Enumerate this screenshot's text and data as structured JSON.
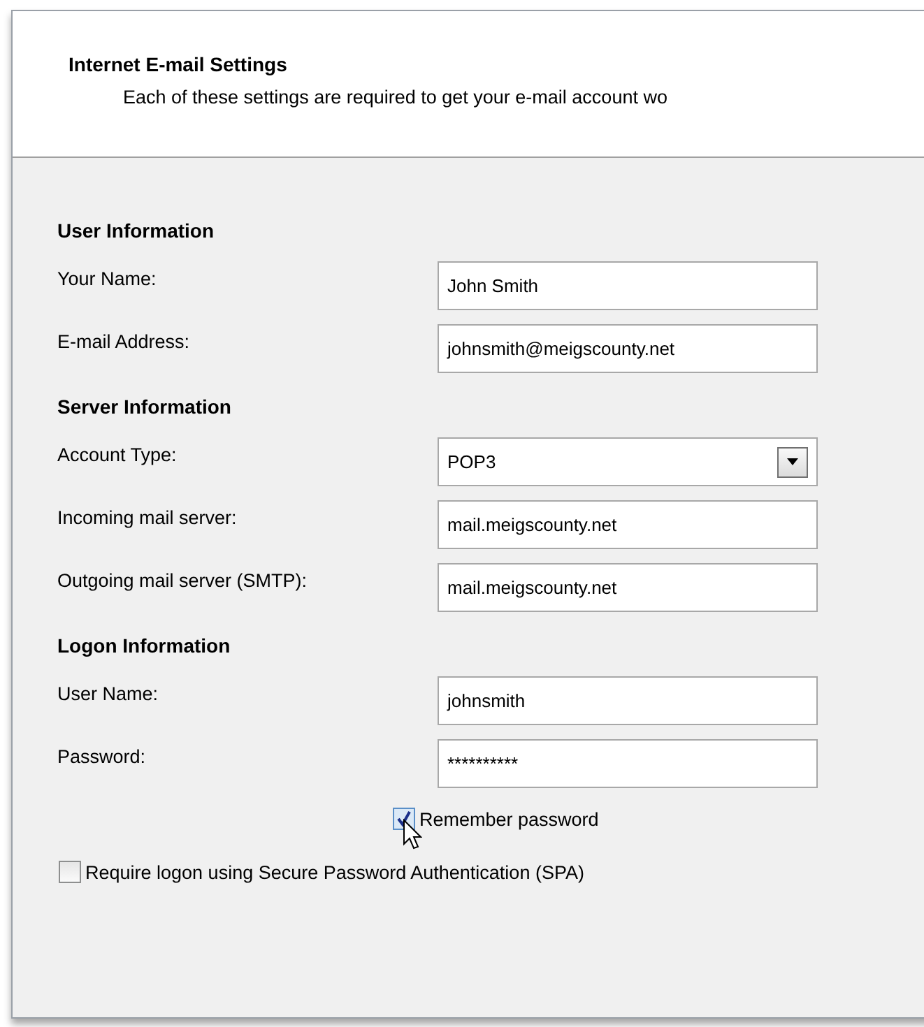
{
  "header": {
    "title": "Internet E-mail Settings",
    "subtitle": "Each of these settings are required to get your e-mail account wo"
  },
  "sections": [
    {
      "heading": "User Information",
      "fields": [
        {
          "kind": "text",
          "label": "Your Name:",
          "value": "John Smith"
        },
        {
          "kind": "text",
          "label": "E-mail Address:",
          "value": "johnsmith@meigscounty.net"
        }
      ]
    },
    {
      "heading": "Server Information",
      "fields": [
        {
          "kind": "dropdown",
          "label": "Account Type:",
          "value": "POP3"
        },
        {
          "kind": "text",
          "label": "Incoming mail server:",
          "value": "mail.meigscounty.net"
        },
        {
          "kind": "text",
          "label": "Outgoing mail server (SMTP):",
          "value": "mail.meigscounty.net"
        }
      ]
    },
    {
      "heading": "Logon Information",
      "fields": [
        {
          "kind": "text",
          "label": "User Name:",
          "value": "johnsmith"
        },
        {
          "kind": "text",
          "label": "Password:",
          "value": "**********"
        }
      ]
    }
  ],
  "checkboxes": [
    {
      "label": "Remember password",
      "checked": true,
      "indented": true
    },
    {
      "label": "Require logon using Secure Password Authentication (SPA)",
      "checked": false,
      "indented": false
    }
  ]
}
